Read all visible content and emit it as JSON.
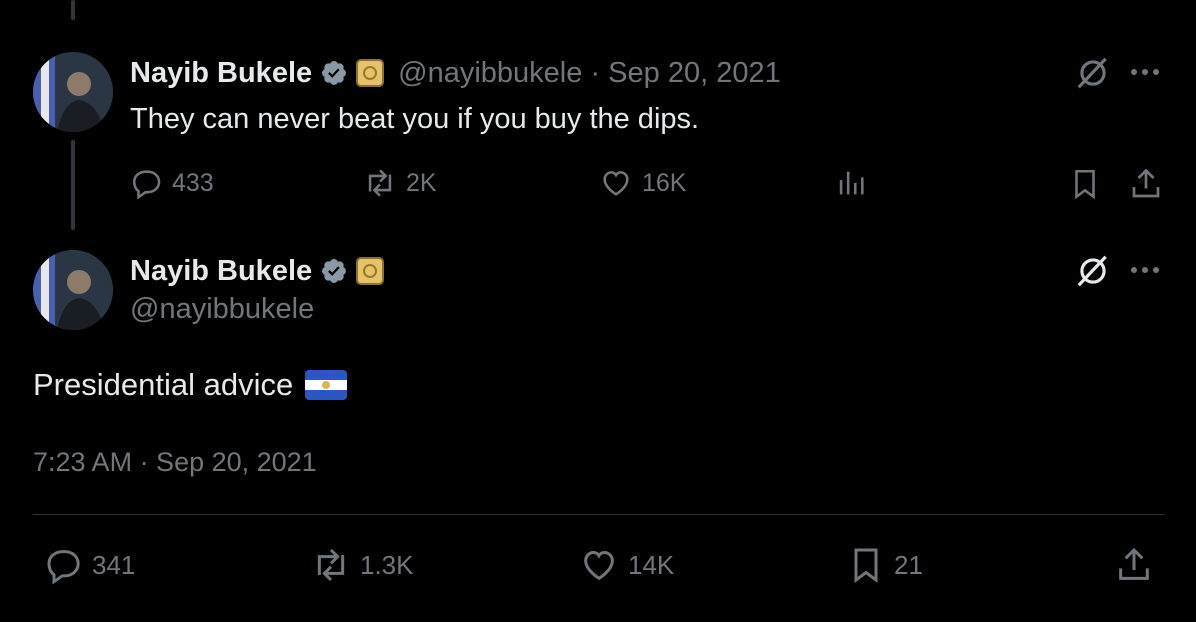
{
  "thread": {
    "parent": {
      "author_name": "Nayib Bukele",
      "handle": "@nayibbukele",
      "separator": "·",
      "date": "Sep 20, 2021",
      "text": "They can never beat you if you buy the dips.",
      "replies": "433",
      "reposts": "2K",
      "likes": "16K"
    },
    "main": {
      "author_name": "Nayib Bukele",
      "handle": "@nayibbukele",
      "text": "Presidential advice",
      "timestamp": "7:23 AM · Sep 20, 2021",
      "replies": "341",
      "reposts": "1.3K",
      "likes": "14K",
      "bookmarks": "21"
    }
  },
  "colors": {
    "background": "#000000",
    "text": "#e7e9ea",
    "muted": "#71767b",
    "verified_badge": "#8b98a5"
  },
  "icons": [
    "reply-icon",
    "repost-icon",
    "like-icon",
    "views-icon",
    "bookmark-icon",
    "share-icon",
    "grok-icon",
    "more-icon",
    "verified-icon",
    "government-badge-icon",
    "el-salvador-flag-icon"
  ]
}
